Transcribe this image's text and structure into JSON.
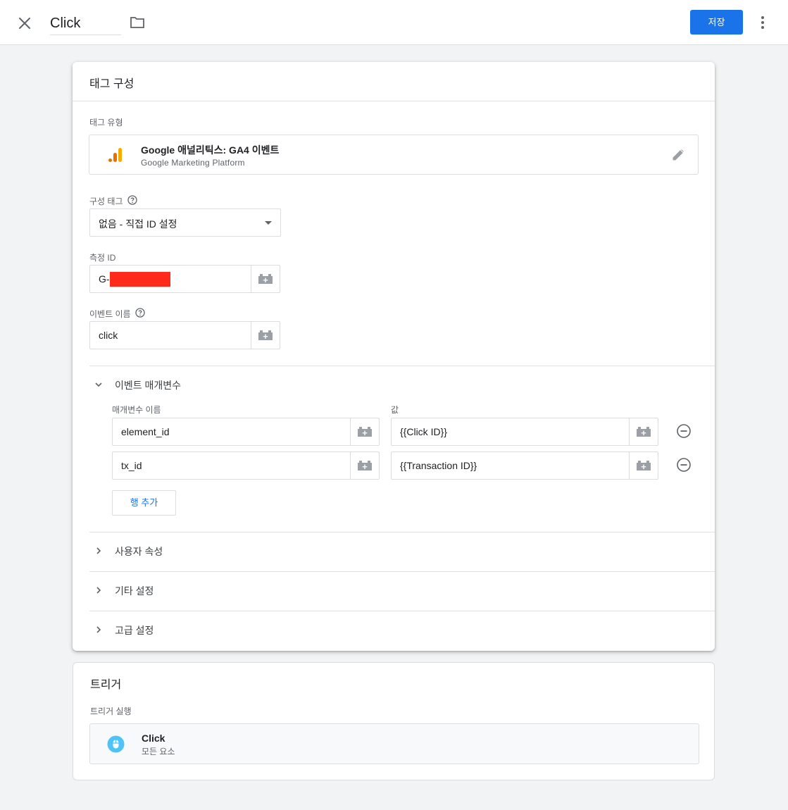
{
  "topbar": {
    "tag_name": "Click",
    "save_label": "저장"
  },
  "tag_config": {
    "title": "태그 구성",
    "tag_type_label": "태그 유형",
    "tag_type_name": "Google 애널리틱스: GA4 이벤트",
    "tag_type_vendor": "Google Marketing Platform",
    "config_tag_label": "구성 태그",
    "config_tag_value": "없음 - 직접 ID 설정",
    "measurement_id_label": "측정 ID",
    "measurement_id_value": "G-",
    "event_name_label": "이벤트 이름",
    "event_name_value": "click",
    "params_section_label": "이벤트 매개변수",
    "param_name_col": "매개변수 이름",
    "param_value_col": "값",
    "params": [
      {
        "name": "element_id",
        "value": "{{Click ID}}"
      },
      {
        "name": "tx_id",
        "value": "{{Transaction ID}}"
      }
    ],
    "add_row_label": "행 추가",
    "user_props_label": "사용자 속성",
    "other_settings_label": "기타 설정",
    "advanced_settings_label": "고급 설정"
  },
  "trigger": {
    "title": "트리거",
    "firing_label": "트리거 실행",
    "name": "Click",
    "description": "모든 요소"
  },
  "colors": {
    "accent": "#1a73e8",
    "ga_orange": "#f9ab00",
    "ga_dark_orange": "#e37400",
    "trigger_icon": "#4fc3f7",
    "redaction": "#ff2a1a"
  }
}
